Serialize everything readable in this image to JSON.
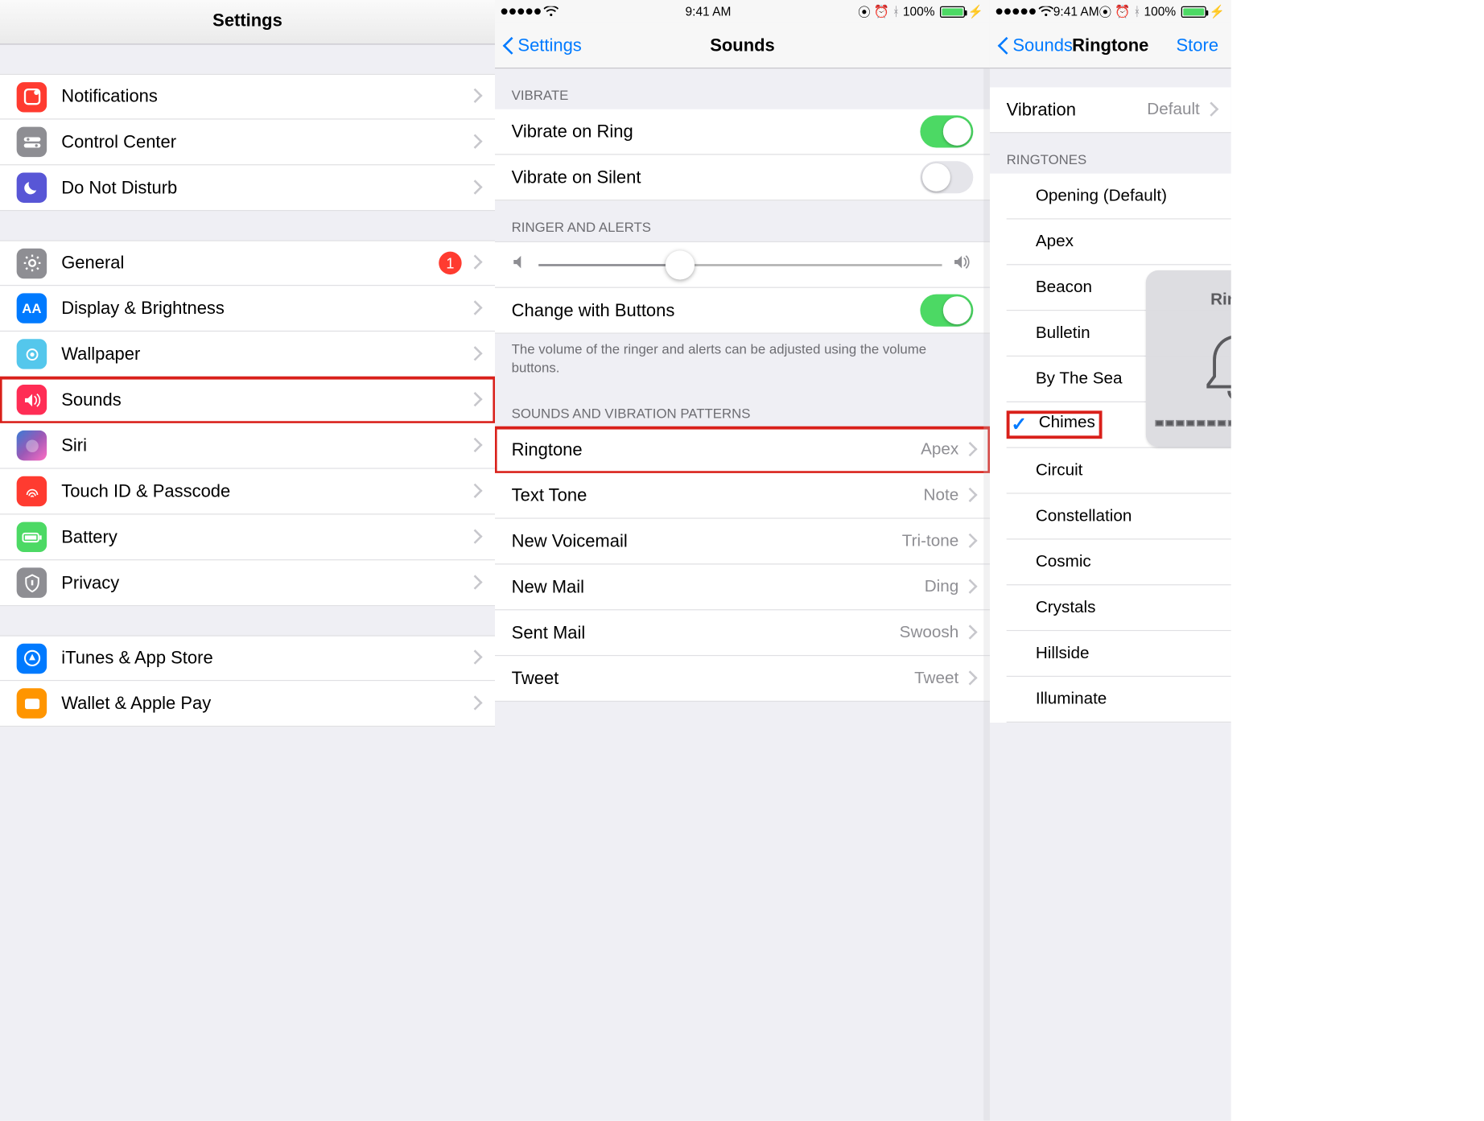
{
  "statusbar": {
    "time": "9:41 AM",
    "battery_pct": "100%"
  },
  "panel1": {
    "title": "Settings",
    "group1": [
      {
        "key": "notifications",
        "label": "Notifications"
      },
      {
        "key": "control-center",
        "label": "Control Center"
      },
      {
        "key": "dnd",
        "label": "Do Not Disturb"
      }
    ],
    "group2": [
      {
        "key": "general",
        "label": "General",
        "badge": "1"
      },
      {
        "key": "display",
        "label": "Display & Brightness"
      },
      {
        "key": "wallpaper",
        "label": "Wallpaper"
      },
      {
        "key": "sounds",
        "label": "Sounds",
        "highlight": true
      },
      {
        "key": "siri",
        "label": "Siri"
      },
      {
        "key": "touchid",
        "label": "Touch ID & Passcode"
      },
      {
        "key": "battery",
        "label": "Battery"
      },
      {
        "key": "privacy",
        "label": "Privacy"
      }
    ],
    "group3": [
      {
        "key": "appstore",
        "label": "iTunes & App Store"
      },
      {
        "key": "wallet",
        "label": "Wallet & Apple Pay"
      }
    ]
  },
  "panel2": {
    "back": "Settings",
    "title": "Sounds",
    "section_vibrate": "Vibrate",
    "vibrate_ring": "Vibrate on Ring",
    "vibrate_silent": "Vibrate on Silent",
    "section_ringer": "Ringer and Alerts",
    "change_buttons": "Change with Buttons",
    "footer_ringer": "The volume of the ringer and alerts can be adjusted using the volume buttons.",
    "section_patterns": "Sounds and Vibration Patterns",
    "rows": [
      {
        "key": "ringtone",
        "label": "Ringtone",
        "value": "Apex",
        "highlight": true
      },
      {
        "key": "texttone",
        "label": "Text Tone",
        "value": "Note"
      },
      {
        "key": "voicemail",
        "label": "New Voicemail",
        "value": "Tri-tone"
      },
      {
        "key": "newmail",
        "label": "New Mail",
        "value": "Ding"
      },
      {
        "key": "sentmail",
        "label": "Sent Mail",
        "value": "Swoosh"
      },
      {
        "key": "tweet",
        "label": "Tweet",
        "value": "Tweet"
      }
    ]
  },
  "panel3": {
    "back": "Sounds",
    "title": "Ringtone",
    "store": "Store",
    "vibration_label": "Vibration",
    "vibration_value": "Default",
    "section_ringtones": "Ringtones",
    "hud_title": "Ringer",
    "ringtones": [
      {
        "label": "Opening (Default)"
      },
      {
        "label": "Apex"
      },
      {
        "label": "Beacon"
      },
      {
        "label": "Bulletin"
      },
      {
        "label": "By The Sea"
      },
      {
        "label": "Chimes",
        "selected": true,
        "highlight": true
      },
      {
        "label": "Circuit"
      },
      {
        "label": "Constellation"
      },
      {
        "label": "Cosmic"
      },
      {
        "label": "Crystals"
      },
      {
        "label": "Hillside"
      },
      {
        "label": "Illuminate"
      }
    ]
  }
}
